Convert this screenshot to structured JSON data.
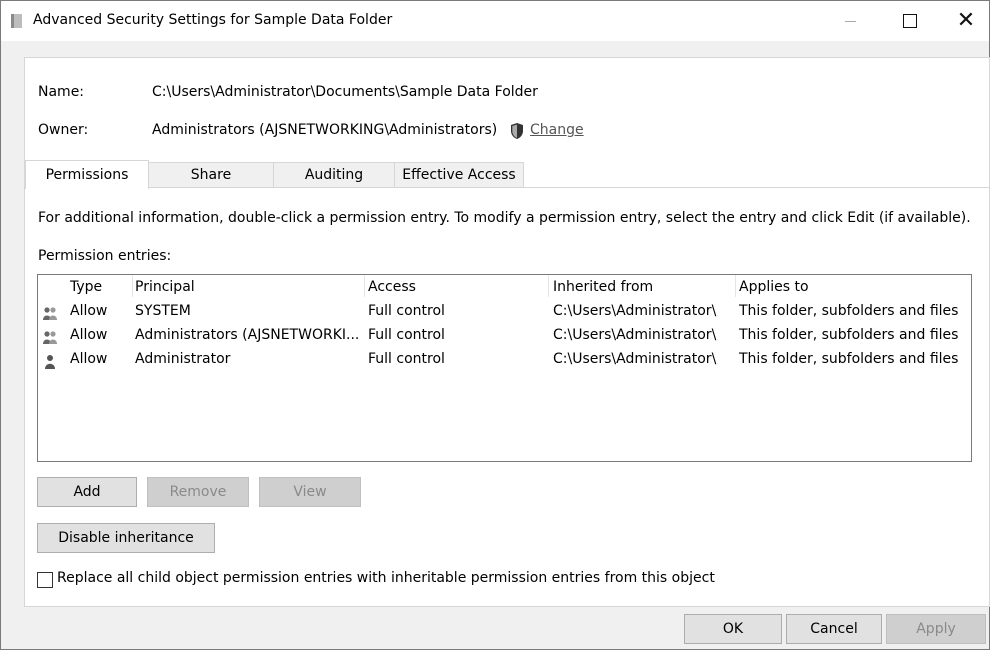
{
  "window": {
    "title": "Advanced Security Settings for Sample Data Folder"
  },
  "info": {
    "name_label": "Name:",
    "name_value": "C:\\Users\\Administrator\\Documents\\Sample Data Folder",
    "owner_label": "Owner:",
    "owner_value": "Administrators (AJSNETWORKING\\Administrators)",
    "change_label": "Change"
  },
  "tabs": [
    {
      "label": "Permissions",
      "active": true
    },
    {
      "label": "Share"
    },
    {
      "label": "Auditing"
    },
    {
      "label": "Effective Access"
    }
  ],
  "instructions": "For additional information, double-click a permission entry. To modify a permission entry, select the entry and click Edit (if available).",
  "entries_label": "Permission entries:",
  "table": {
    "headers": [
      "Type",
      "Principal",
      "Access",
      "Inherited from",
      "Applies to"
    ],
    "rows": [
      {
        "icon": "group-icon",
        "type": "Allow",
        "principal": "SYSTEM",
        "access": "Full control",
        "inherited": "C:\\Users\\Administrator\\",
        "applies": "This folder, subfolders and files"
      },
      {
        "icon": "group-icon",
        "type": "Allow",
        "principal": "Administrators (AJSNETWORKI...",
        "access": "Full control",
        "inherited": "C:\\Users\\Administrator\\",
        "applies": "This folder, subfolders and files"
      },
      {
        "icon": "user-icon",
        "type": "Allow",
        "principal": "Administrator",
        "access": "Full control",
        "inherited": "C:\\Users\\Administrator\\",
        "applies": "This folder, subfolders and files"
      }
    ]
  },
  "buttons": {
    "add": "Add",
    "remove": "Remove",
    "view": "View",
    "disable_inheritance": "Disable inheritance",
    "ok": "OK",
    "cancel": "Cancel",
    "apply": "Apply"
  },
  "checkbox": {
    "label": "Replace all child object permission entries with inheritable permission entries from this object",
    "checked": false
  }
}
